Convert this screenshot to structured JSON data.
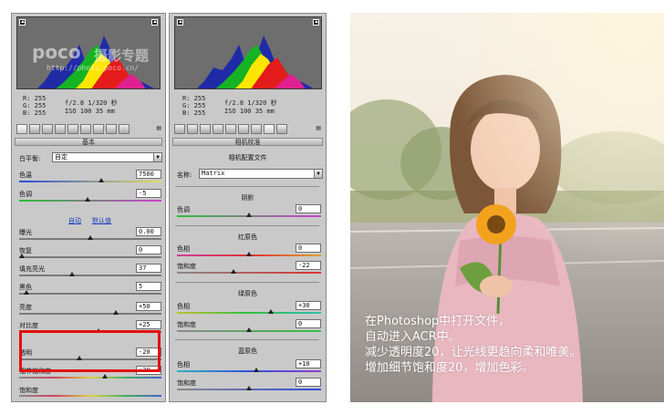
{
  "watermark": {
    "brand": "poco",
    "title": "摄影专题",
    "url": "http://photo.poco.cn/"
  },
  "left_panel": {
    "rgb": {
      "r": "R: 255",
      "g": "G: 255",
      "b": "B: 255"
    },
    "exif": {
      "line1": "f/2.8  1/320 秒",
      "line2": "ISO 100  35 mm"
    },
    "section_title": "基本",
    "white_balance": {
      "label": "白平衡:",
      "value": "自定"
    },
    "temperature": {
      "label": "色温",
      "value": "7500",
      "level": 0.58
    },
    "tint": {
      "label": "色调",
      "value": "-5",
      "level": 0.48
    },
    "links": {
      "auto": "自动",
      "default": "默认值"
    },
    "exposure": {
      "label": "曝光",
      "value": "0.00",
      "level": 0.5
    },
    "recovery": {
      "label": "恢复",
      "value": "0",
      "level": 0.02
    },
    "fill_light": {
      "label": "填充亮光",
      "value": "37",
      "level": 0.37
    },
    "blacks": {
      "label": "黑色",
      "value": "5",
      "level": 0.05
    },
    "brightness": {
      "label": "亮度",
      "value": "+50",
      "level": 0.68
    },
    "contrast": {
      "label": "对比度",
      "value": "+25",
      "level": 0.56
    },
    "clarity": {
      "label": "透明",
      "value": "-20",
      "level": 0.42
    },
    "vibrance": {
      "label": "细节饱和度",
      "value": "+20",
      "level": 0.6
    },
    "saturation": {
      "label": "饱和度",
      "value": "",
      "level": 0.5
    }
  },
  "right_panel": {
    "rgb": {
      "r": "R: 255",
      "g": "G: 255",
      "b": "B: 255"
    },
    "exif": {
      "line1": "f/2.8  1/320 秒",
      "line2": "ISO 100  35 mm"
    },
    "section_title": "相机校准",
    "profile_title": "相机配置文件",
    "profile": {
      "label": "名称:",
      "value": "Matrix"
    },
    "shadows": {
      "title": "阴影",
      "tint_label": "色调",
      "tint_value": "0",
      "tint_level": 0.5
    },
    "red": {
      "title": "红原色",
      "hue_label": "色相",
      "hue_value": "0",
      "hue_level": 0.5,
      "sat_label": "饱和度",
      "sat_value": "-22",
      "sat_level": 0.39
    },
    "green": {
      "title": "绿原色",
      "hue_label": "色相",
      "hue_value": "+30",
      "hue_level": 0.65,
      "sat_label": "饱和度",
      "sat_value": "0",
      "sat_level": 0.5
    },
    "blue": {
      "title": "蓝原色",
      "hue_label": "色相",
      "hue_value": "+10",
      "hue_level": 0.55,
      "sat_label": "饱和度",
      "sat_value": "0",
      "sat_level": 0.5
    }
  },
  "caption": {
    "line1": "在Photoshop中打开文件，",
    "line2": "自动进入ACR中。",
    "line3": "减少透明度20，让光线更趋向柔和唯美。",
    "line4": "增加细节饱和度20，增加色彩。"
  },
  "colors": {
    "highlight": "#e01010",
    "link": "#1b3fbf",
    "panel": "#c9c9c9"
  }
}
